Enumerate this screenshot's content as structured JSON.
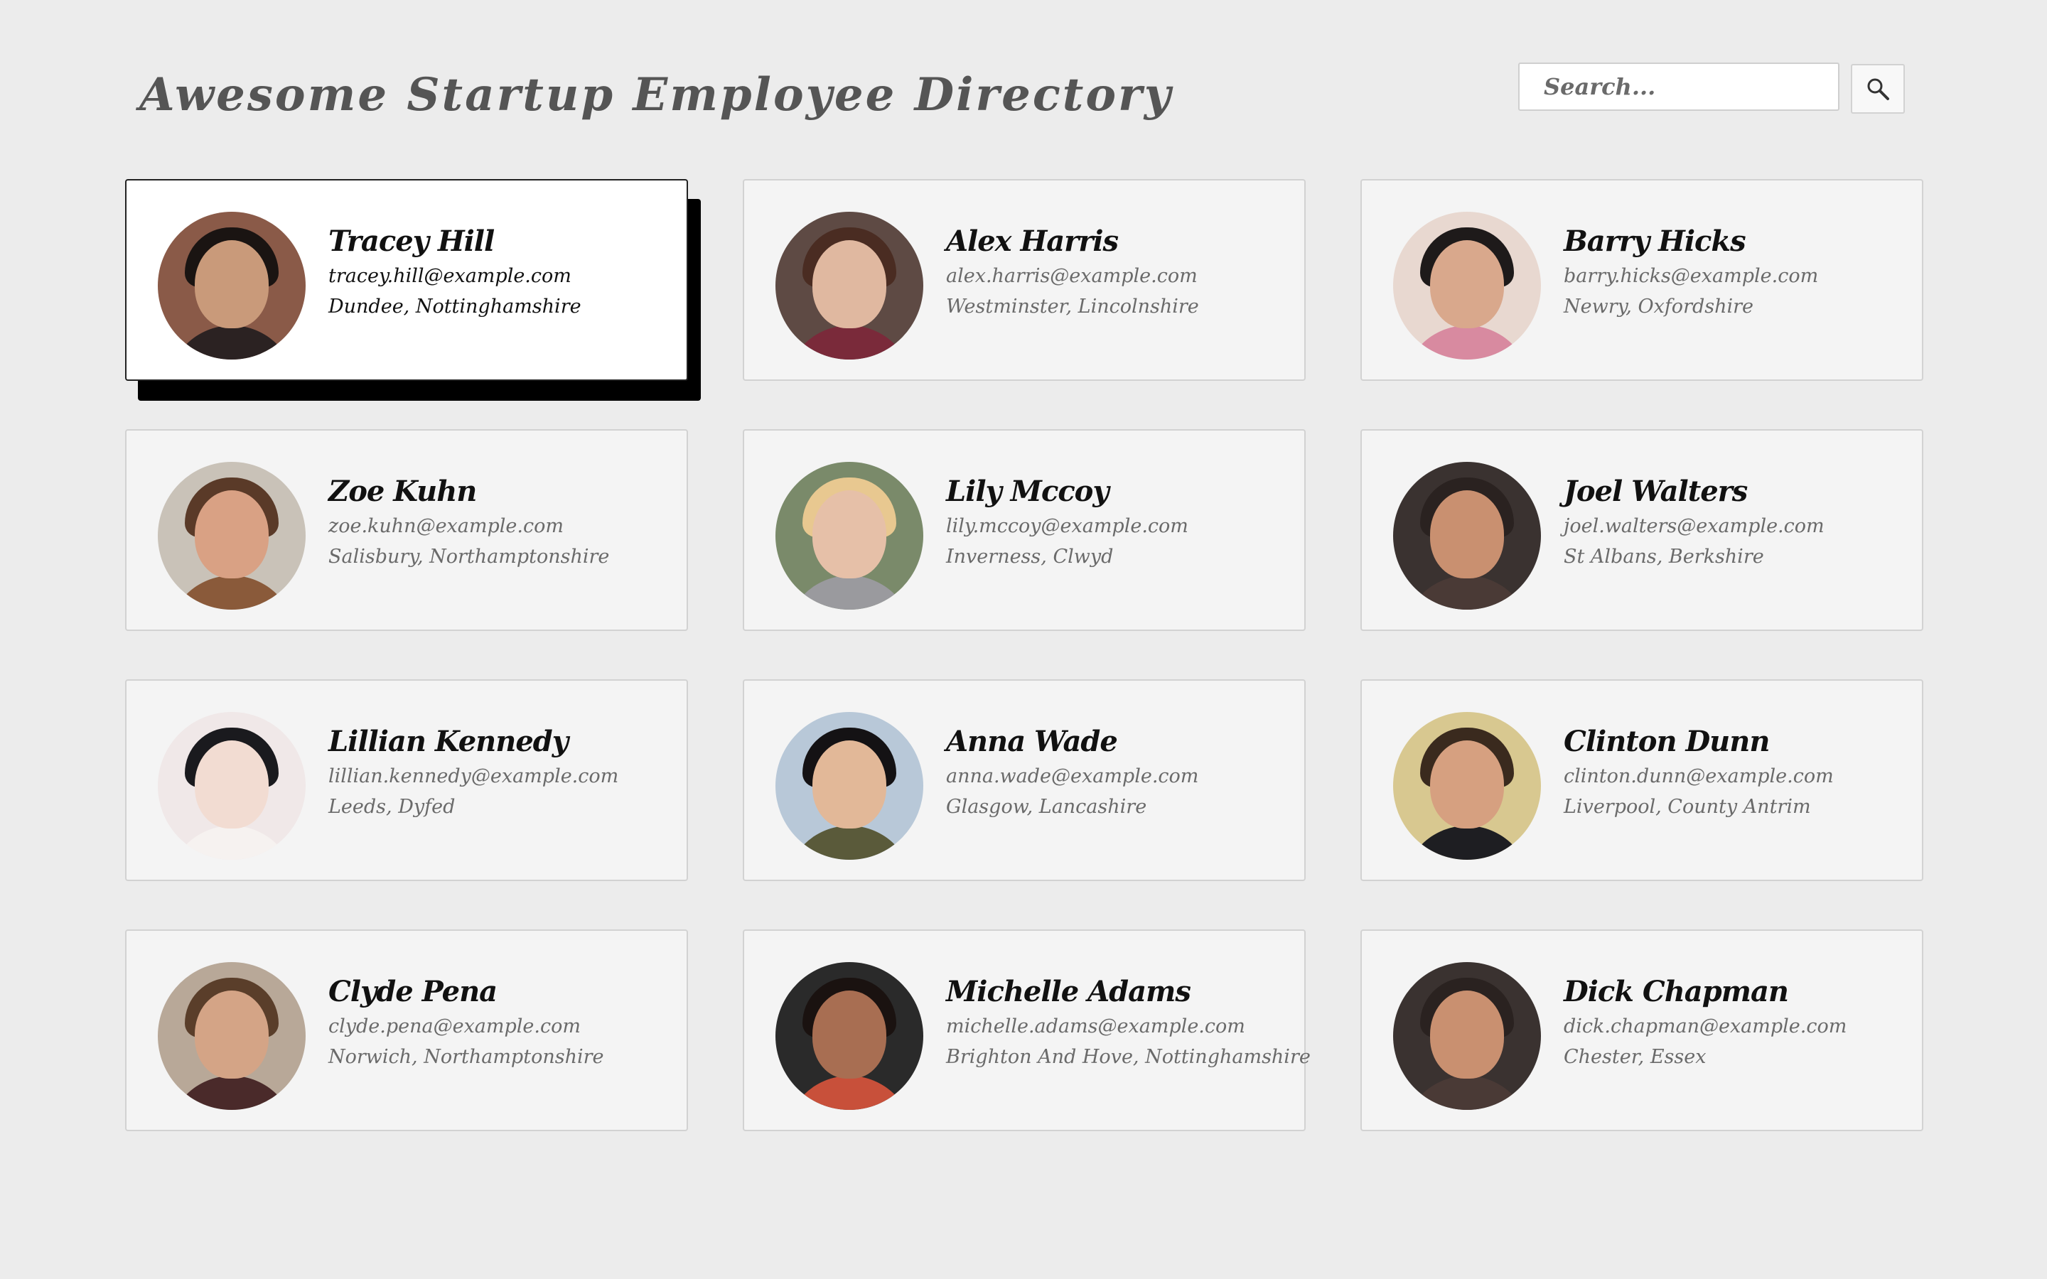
{
  "header": {
    "title": "Awesome Startup Employee Directory",
    "search_placeholder": "Search...",
    "search_icon": "magnifier-icon"
  },
  "colors": {
    "background": "#ececec",
    "card": "#f4f4f4",
    "card_selected": "#ffffff",
    "card_selected_shadow": "#000000",
    "title": "#555555",
    "muted_text": "#6a6a6a"
  },
  "selected_employee_index": 0,
  "employees": [
    {
      "name": "Tracey Hill",
      "email": "tracey.hill@example.com",
      "location": "Dundee, Nottinghamshire",
      "photo": {
        "bg": "#8a5a48",
        "skin": "#c99a7a",
        "hair": "#1a1412",
        "shirt": "#2b2222"
      }
    },
    {
      "name": "Alex Harris",
      "email": "alex.harris@example.com",
      "location": "Westminster, Lincolnshire",
      "photo": {
        "bg": "#5e4a44",
        "skin": "#e0b8a0",
        "hair": "#4a2c22",
        "shirt": "#7a2a3a"
      }
    },
    {
      "name": "Barry Hicks",
      "email": "barry.hicks@example.com",
      "location": "Newry, Oxfordshire",
      "photo": {
        "bg": "#e8d8d0",
        "skin": "#d9a88c",
        "hair": "#1e1a1a",
        "shirt": "#d88aa0"
      }
    },
    {
      "name": "Zoe Kuhn",
      "email": "zoe.kuhn@example.com",
      "location": "Salisbury, Northamptonshire",
      "photo": {
        "bg": "#c9c2b8",
        "skin": "#d9a184",
        "hair": "#5a3a28",
        "shirt": "#8a5a3a"
      }
    },
    {
      "name": "Lily Mccoy",
      "email": "lily.mccoy@example.com",
      "location": "Inverness, Clwyd",
      "photo": {
        "bg": "#7a8a6a",
        "skin": "#e6c0a8",
        "hair": "#e8c890",
        "shirt": "#9a9a9e"
      }
    },
    {
      "name": "Joel Walters",
      "email": "joel.walters@example.com",
      "location": "St Albans, Berkshire",
      "photo": {
        "bg": "#3a3230",
        "skin": "#c99070",
        "hair": "#2a2220",
        "shirt": "#4a3a36"
      }
    },
    {
      "name": "Lillian Kennedy",
      "email": "lillian.kennedy@example.com",
      "location": "Leeds, Dyfed",
      "photo": {
        "bg": "#f0e8e8",
        "skin": "#f2dcd2",
        "hair": "#1a1a1e",
        "shirt": "#f6f2f0"
      }
    },
    {
      "name": "Anna Wade",
      "email": "anna.wade@example.com",
      "location": "Glasgow, Lancashire",
      "photo": {
        "bg": "#b8c8d8",
        "skin": "#e2b898",
        "hair": "#141214",
        "shirt": "#5a5a3a"
      }
    },
    {
      "name": "Clinton Dunn",
      "email": "clinton.dunn@example.com",
      "location": "Liverpool, County Antrim",
      "photo": {
        "bg": "#d8c890",
        "skin": "#d6a080",
        "hair": "#3a2a1e",
        "shirt": "#1e1e22"
      }
    },
    {
      "name": "Clyde Pena",
      "email": "clyde.pena@example.com",
      "location": "Norwich, Northamptonshire",
      "photo": {
        "bg": "#b8a898",
        "skin": "#d4a486",
        "hair": "#5a3e2a",
        "shirt": "#4a2a2a"
      }
    },
    {
      "name": "Michelle Adams",
      "email": "michelle.adams@example.com",
      "location": "Brighton And Hove, Nottinghamshire",
      "photo": {
        "bg": "#2a2a2a",
        "skin": "#a86e52",
        "hair": "#1a1210",
        "shirt": "#c8503a"
      }
    },
    {
      "name": "Dick Chapman",
      "email": "dick.chapman@example.com",
      "location": "Chester, Essex",
      "photo": {
        "bg": "#3a3230",
        "skin": "#c99070",
        "hair": "#2a2220",
        "shirt": "#4a3a36"
      }
    }
  ]
}
